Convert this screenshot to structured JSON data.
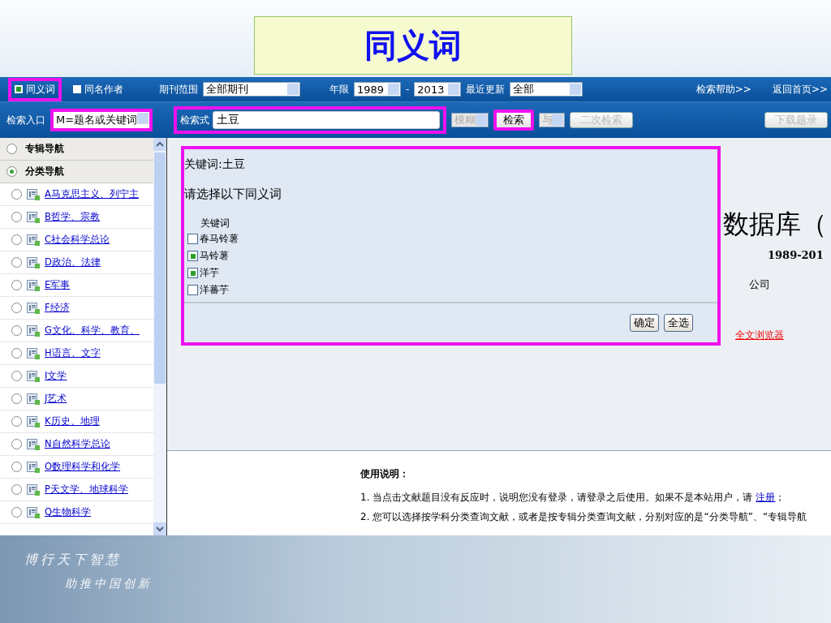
{
  "slide_title": "同义词",
  "toolbar": {
    "synonym": {
      "label": "同义词",
      "checked": true,
      "highlighted": true
    },
    "same_author": {
      "label": "同名作者",
      "checked": false
    },
    "range": {
      "label": "期刊范围",
      "value": "全部期刊"
    },
    "years": {
      "label": "年限",
      "from": "1989",
      "dash": "-",
      "to": "2013"
    },
    "update": {
      "label": "最近更新",
      "value": "全部"
    },
    "links": [
      "检索帮助>>",
      "返回首页>>"
    ],
    "entry": {
      "label": "检索入口",
      "value": "M=题名或关键词",
      "highlighted": true
    },
    "query": {
      "label": "检索式",
      "value": "土豆",
      "highlighted": true
    },
    "match": {
      "value": "模糊",
      "disabled": true
    },
    "search_button": {
      "label": "检索",
      "disabled": false,
      "highlighted": true
    },
    "logic": {
      "value": "与",
      "disabled": true
    },
    "secondary_button": {
      "label": "二次检索",
      "disabled": true
    },
    "download_button": {
      "label": "下载题录",
      "disabled": true
    }
  },
  "sidebar": {
    "modes": [
      {
        "label": "专辑导航",
        "selected": false
      },
      {
        "label": "分类导航",
        "selected": true
      }
    ],
    "items": [
      {
        "label": "A马克思主义、列宁主",
        "selected": false
      },
      {
        "label": "B哲学、宗教",
        "selected": false
      },
      {
        "label": "C社会科学总论",
        "selected": false
      },
      {
        "label": "D政治、法律",
        "selected": false
      },
      {
        "label": "E军事",
        "selected": false
      },
      {
        "label": "F经济",
        "selected": false
      },
      {
        "label": "G文化、科学、教育、",
        "selected": false
      },
      {
        "label": "H语言、文字",
        "selected": false
      },
      {
        "label": "I文学",
        "selected": false
      },
      {
        "label": "J艺术",
        "selected": false
      },
      {
        "label": "K历史、地理",
        "selected": false
      },
      {
        "label": "N自然科学总论",
        "selected": false
      },
      {
        "label": "O数理科学和化学",
        "selected": false
      },
      {
        "label": "P天文学、地球科学",
        "selected": false
      },
      {
        "label": "Q生物科学",
        "selected": false
      }
    ]
  },
  "background": {
    "db_title": "数据库（",
    "years": "1989-201",
    "company": "公司",
    "browser_link": "全文浏览器"
  },
  "dialog": {
    "highlighted": true,
    "keyword_line": "关键词:土豆",
    "prompt": "请选择以下同义词",
    "list_header": "关键词",
    "options": [
      {
        "label": "春马铃薯",
        "checked": false
      },
      {
        "label": "马铃薯",
        "checked": true
      },
      {
        "label": "洋芋",
        "checked": true
      },
      {
        "label": "洋蕃芋",
        "checked": false
      }
    ],
    "buttons": [
      "确定",
      "全选"
    ]
  },
  "instructions": {
    "title": "使用说明：",
    "items": [
      {
        "number": "1.",
        "text": "当点击文献题目没有反应时，说明您没有登录，请登录之后使用。如果不是本站用户，请",
        "link": "注册",
        "tail": "；"
      },
      {
        "number": "2.",
        "text": "您可以选择按学科分类查询文献，或者是按专辑分类查询文献，分别对应的是“分类导航”、“专辑导航"
      }
    ]
  },
  "banner": {
    "line1": "博行天下智慧",
    "line2": "助推中国创新"
  }
}
